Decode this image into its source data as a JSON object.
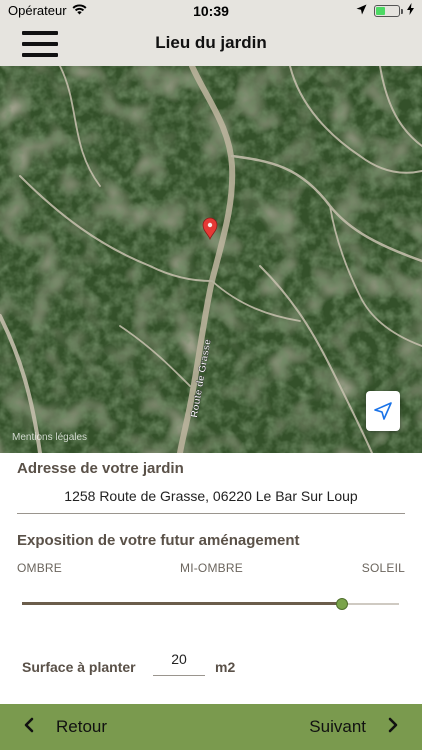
{
  "status_bar": {
    "carrier": "Opérateur",
    "time": "10:39",
    "icons": [
      "wifi-icon",
      "location-arrow-icon",
      "battery-icon",
      "charging-bolt-icon"
    ]
  },
  "nav": {
    "title": "Lieu du jardin",
    "menu_icon": "hamburger-menu-icon"
  },
  "map": {
    "road_label": "Route de Grasse",
    "legal_link": "Mentions légales",
    "pin_icon": "map-pin-icon",
    "locate_icon": "navigation-arrow-icon"
  },
  "form": {
    "address_label": "Adresse de votre jardin",
    "address_value": "1258 Route de Grasse, 06220 Le Bar Sur Loup",
    "exposure_label": "Exposition de votre futur aménagement",
    "exposure_scale": [
      "OMBRE",
      "MI-OMBRE",
      "SOLEIL"
    ],
    "exposure_value": 0.85,
    "surface_label": "Surface à planter",
    "surface_value": "20",
    "surface_unit": "m2"
  },
  "footer": {
    "back_label": "Retour",
    "next_label": "Suivant"
  },
  "colors": {
    "bar_background": "#e6e4df",
    "footer_background": "#7a9a4e",
    "label_text": "#5a5148",
    "slider_thumb": "#7aa34a",
    "pin": "#e53935"
  }
}
